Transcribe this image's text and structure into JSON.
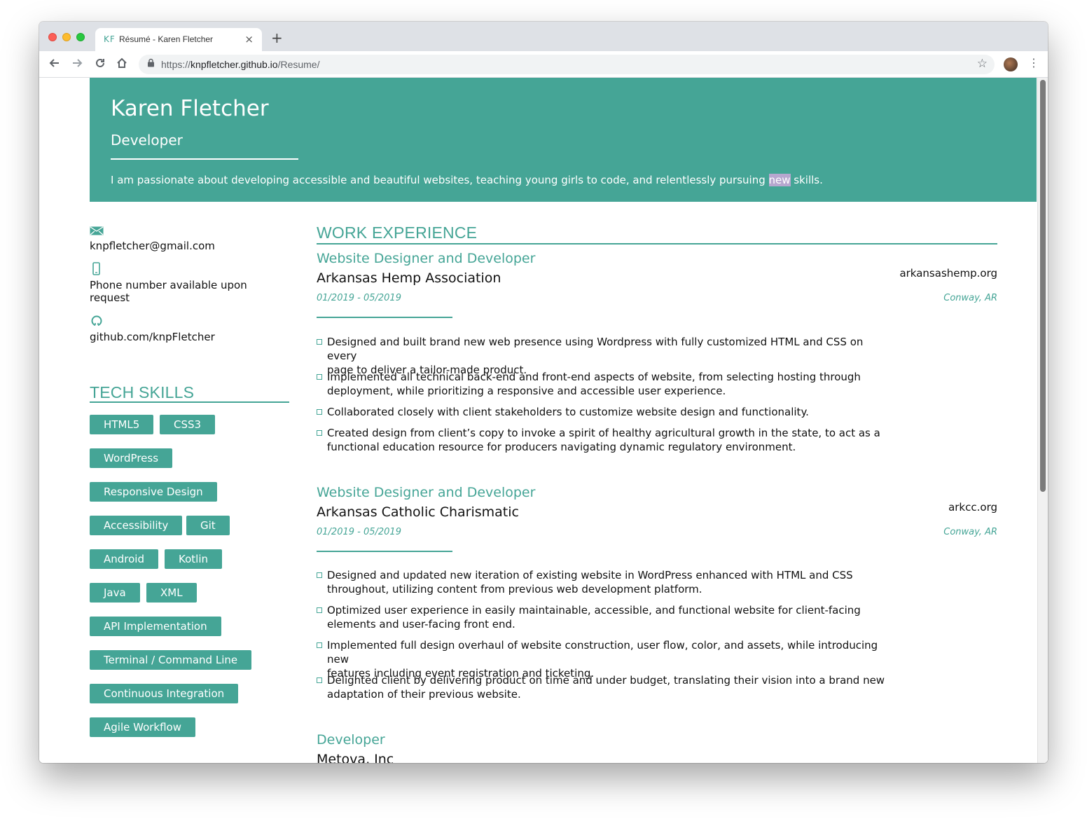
{
  "browser": {
    "tab_favicon": "KF",
    "tab_title": "Résumé - Karen Fletcher",
    "tab_close": "×",
    "new_tab": "+",
    "url_scheme": "https://",
    "url_host": "knpfletcher.github.io",
    "url_path": "/Resume/"
  },
  "header": {
    "name": "Karen Fletcher",
    "role": "Developer",
    "tagline_before": "I am passionate about developing accessible and beautiful websites, teaching young girls to code, and relentlessly pursuing ",
    "tagline_highlight": "new",
    "tagline_after": " skills."
  },
  "contact": {
    "email": "knpfletcher@gmail.com",
    "phone_line1": "Phone number available upon",
    "phone_line2": "request",
    "github": "github.com/knpFletcher"
  },
  "skills": {
    "title": "TECH SKILLS",
    "items": [
      "HTML5",
      "CSS3",
      "WordPress",
      "Responsive Design",
      "Accessibility",
      "Git",
      "Android",
      "Kotlin",
      "Java",
      "XML",
      "API Implementation",
      "Terminal / Command Line",
      "Continuous Integration",
      "Agile Workflow"
    ]
  },
  "experience": {
    "title": "WORK EXPERIENCE",
    "jobs": [
      {
        "title": "Website Designer and Developer",
        "company": "Arkansas Hemp Association",
        "site": "arkansashemp.org",
        "dates": "01/2019 - 05/2019",
        "location": "Conway, AR",
        "bullets": [
          [
            "Designed and built brand new web presence using Wordpress with fully customized HTML and CSS on every",
            "page to deliver a tailor-made product."
          ],
          [
            "Implemented all technical back-end and front-end aspects of website, from selecting hosting through",
            "deployment, while prioritizing a responsive and accessible user experience."
          ],
          [
            "Collaborated closely with client stakeholders to customize website design and functionality.",
            ""
          ],
          [
            "Created design from client’s copy to invoke a spirit of healthy agricultural growth in the state, to act as a",
            "functional education resource for producers navigating dynamic regulatory environment."
          ]
        ]
      },
      {
        "title": "Website Designer and Developer",
        "company": "Arkansas Catholic Charismatic",
        "site": "arkcc.org",
        "dates": "01/2019 - 05/2019",
        "location": "Conway, AR",
        "bullets": [
          [
            "Designed and updated new iteration of existing website in WordPress enhanced with HTML and CSS",
            "throughout, utilizing content from previous web development platform."
          ],
          [
            "Optimized user experience in easily maintainable, accessible, and functional website for client-facing",
            "elements and user-facing front end."
          ],
          [
            "Implemented full design overhaul of website construction, user flow, color, and assets, while introducing new",
            "features including event registration and ticketing."
          ],
          [
            "Delighted client by delivering product on time and under budget, translating their vision into a brand new",
            "adaptation of their previous website."
          ]
        ]
      },
      {
        "title": "Developer",
        "company": "Metova, Inc"
      }
    ]
  },
  "icons": {
    "back": "arrow-left-icon",
    "forward": "arrow-right-icon",
    "reload": "reload-icon",
    "home": "home-icon",
    "lock": "lock-icon",
    "bookmark": "star-icon",
    "menu": "kebab-menu-icon",
    "email": "envelope-icon",
    "phone": "phone-icon",
    "github": "github-icon"
  },
  "colors": {
    "accent": "#45a596",
    "highlight": "#b7a7cf"
  }
}
